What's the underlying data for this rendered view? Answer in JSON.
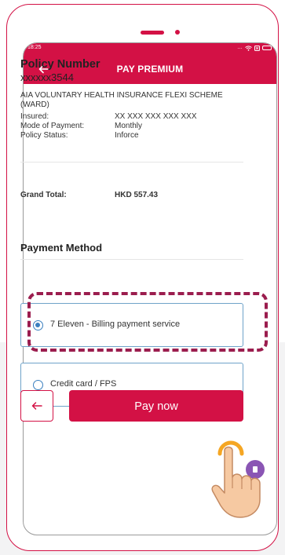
{
  "status_bar": {
    "time": "18:25",
    "icons": [
      "more-icon",
      "wifi-icon",
      "sim-icon",
      "battery-icon"
    ]
  },
  "header": {
    "title": "PAY PREMIUM",
    "back_icon": "arrow-left-icon"
  },
  "policy": {
    "label": "Policy Number",
    "number": "xxxxxx3544",
    "plan_name": "AIA VOLUNTARY HEALTH INSURANCE FLEXI SCHEME (WARD)",
    "insured_label": "Insured:",
    "insured_value": "XX XXX XXX XXX XXX",
    "mode_label": "Mode of Payment:",
    "mode_value": "Monthly",
    "status_label": "Policy Status:",
    "status_value": "Inforce"
  },
  "total": {
    "label": "Grand Total:",
    "value": "HKD 557.43"
  },
  "payment": {
    "title": "Payment Method",
    "options": [
      {
        "label": "7 Eleven - Billing payment service",
        "selected": true
      },
      {
        "label": "Credit card / FPS",
        "selected": false
      }
    ]
  },
  "actions": {
    "back_icon": "arrow-left-icon",
    "pay_label": "Pay now"
  },
  "colors": {
    "brand": "#d31145",
    "highlight": "#9b1d4e",
    "radio": "#3a7fbf",
    "spinner": "#f5a623",
    "bubble": "#8a55b4"
  }
}
